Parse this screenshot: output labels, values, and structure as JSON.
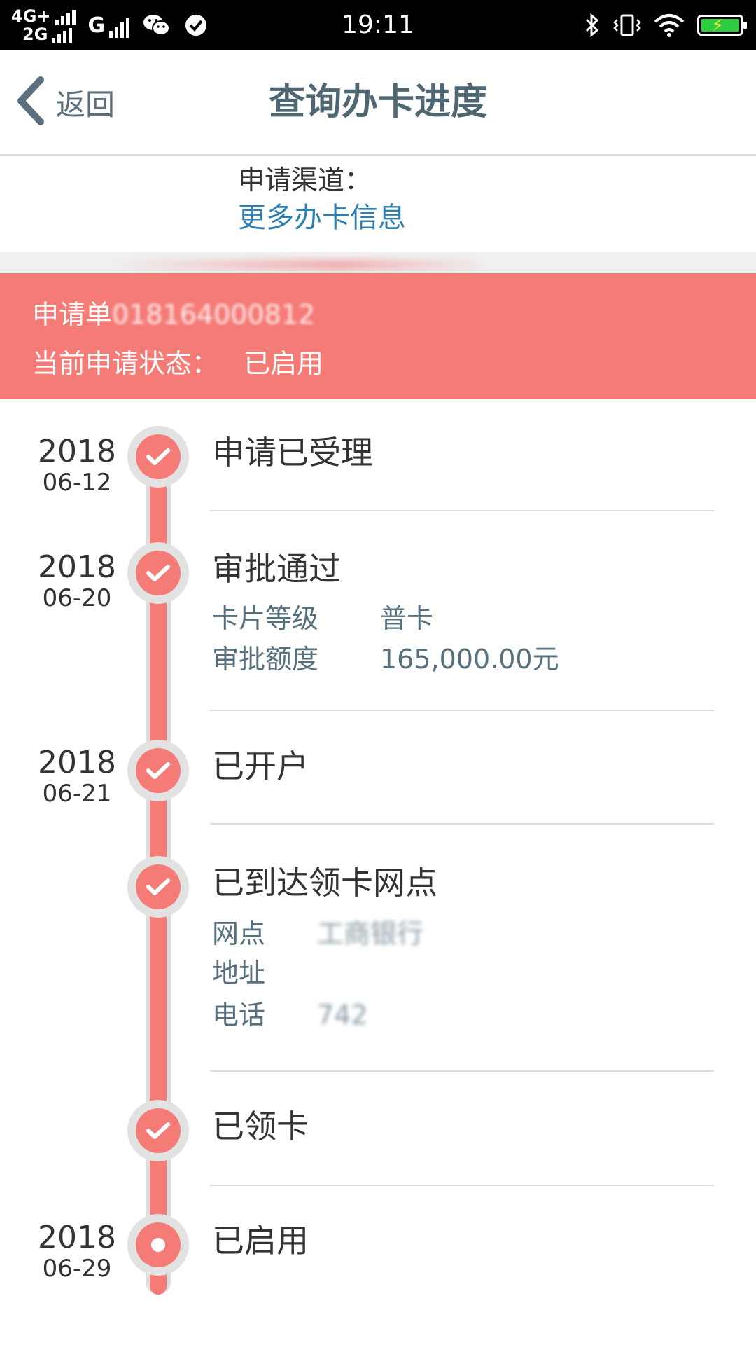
{
  "status_bar": {
    "network_top": "4G+",
    "network_bottom": "2G",
    "network_g": "G",
    "time": "19:11",
    "icons": [
      "signal-icon",
      "wechat-icon",
      "check-circle-icon",
      "bluetooth-icon",
      "vibrate-icon",
      "wifi-icon",
      "battery-charging-icon"
    ]
  },
  "header": {
    "back_label": "返回",
    "title": "查询办卡进度"
  },
  "info": {
    "channel_label": "申请渠道：",
    "more_link": "更多办卡信息"
  },
  "banner": {
    "order_label": "申请单",
    "order_number": "018164000812",
    "status_label": "当前申请状态：",
    "status_value": "已启用"
  },
  "timeline": [
    {
      "year": "2018",
      "date": "06-12",
      "title": "申请已受理",
      "done": true
    },
    {
      "year": "2018",
      "date": "06-20",
      "title": "审批通过",
      "done": true,
      "details": [
        {
          "key": "卡片等级",
          "value": "普卡"
        },
        {
          "key": "审批额度",
          "value": "165,000.00元"
        }
      ]
    },
    {
      "year": "2018",
      "date": "06-21",
      "title": "已开户",
      "done": true
    },
    {
      "year": "",
      "date": "",
      "title": "已到达领卡网点",
      "done": true,
      "details": [
        {
          "key": "网点",
          "value": "工商银行"
        },
        {
          "key": "地址",
          "value": ""
        },
        {
          "key": "电话",
          "value": "742"
        }
      ]
    },
    {
      "year": "",
      "date": "",
      "title": "已领卡",
      "done": true
    },
    {
      "year": "2018",
      "date": "06-29",
      "title": "已启用",
      "done": false,
      "current": true
    }
  ],
  "colors": {
    "accent": "#f47b76",
    "link": "#2f7fb3",
    "title": "#4f6673",
    "detail": "#56707e"
  }
}
